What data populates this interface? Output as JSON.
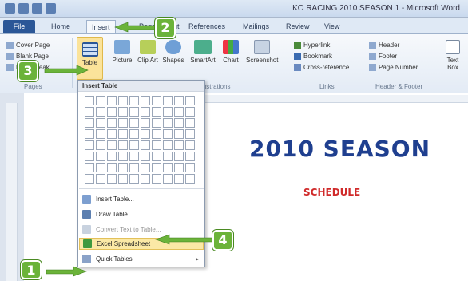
{
  "window": {
    "title": "KO RACING 2010 SEASON 1 - Microsoft Word"
  },
  "tabs": [
    "File",
    "Home",
    "Insert",
    "Page Layout",
    "References",
    "Mailings",
    "Review",
    "View"
  ],
  "ribbon": {
    "pages": [
      "Cover Page",
      "Blank Page",
      "Page Break"
    ],
    "pages_label": "Pages",
    "table_label": "Table",
    "illustrations": [
      "Picture",
      "Clip Art",
      "Shapes",
      "SmartArt",
      "Chart",
      "Screenshot"
    ],
    "illustrations_label": "Illustrations",
    "links": [
      "Hyperlink",
      "Bookmark",
      "Cross-reference"
    ],
    "links_label": "Links",
    "header_footer": [
      "Header",
      "Footer",
      "Page Number"
    ],
    "header_footer_label": "Header & Footer",
    "text_box": "Text Box"
  },
  "menu": {
    "header": "Insert Table",
    "grid_cols": 10,
    "grid_rows": 8,
    "items": [
      {
        "label": "Insert Table...",
        "state": "normal"
      },
      {
        "label": "Draw Table",
        "state": "normal"
      },
      {
        "label": "Convert Text to Table...",
        "state": "disabled"
      },
      {
        "label": "Excel Spreadsheet",
        "state": "highlighted"
      },
      {
        "label": "Quick Tables",
        "state": "submenu"
      }
    ]
  },
  "document": {
    "heading": "2010 SEASON",
    "subheading": "SCHEDULE"
  },
  "callouts": [
    "1",
    "2",
    "3",
    "4"
  ],
  "colors": {
    "accent": "#2b5797",
    "callout": "#6bb33a",
    "heading": "#1f3f8f",
    "subheading": "#d02a2a",
    "highlight": "#fbe9a6"
  }
}
